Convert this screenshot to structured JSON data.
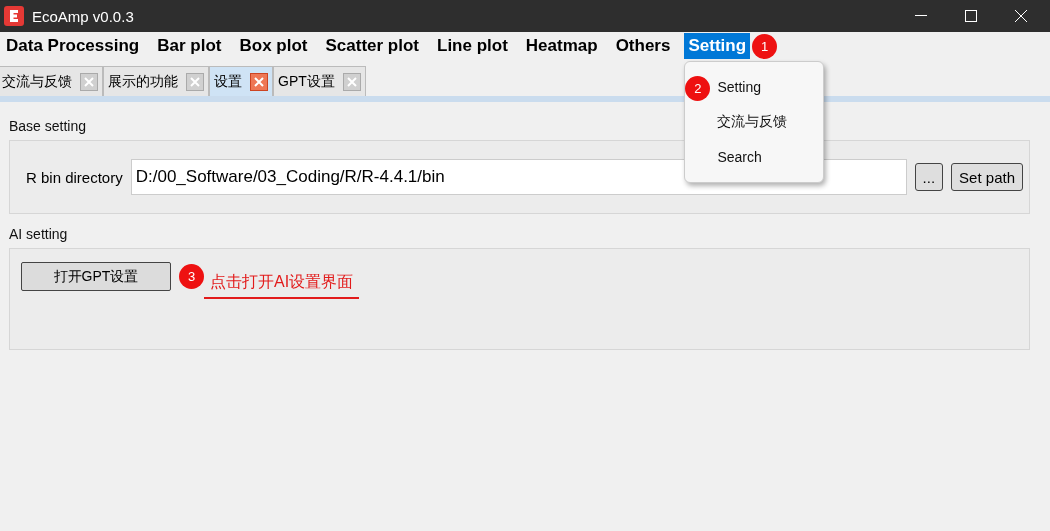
{
  "window": {
    "title": "EcoAmp v0.0.3"
  },
  "menu": [
    {
      "label": "Data Processing",
      "selected": false
    },
    {
      "label": "Bar plot",
      "selected": false
    },
    {
      "label": "Box plot",
      "selected": false
    },
    {
      "label": "Scatter plot",
      "selected": false
    },
    {
      "label": "Line plot",
      "selected": false
    },
    {
      "label": "Heatmap",
      "selected": false
    },
    {
      "label": "Others",
      "selected": false
    },
    {
      "label": "Setting",
      "selected": true
    }
  ],
  "dropdown": {
    "items": [
      "Setting",
      "交流与反馈",
      "Search"
    ]
  },
  "tabs": [
    {
      "label": "交流与反馈",
      "selected": false
    },
    {
      "label": "展示的功能",
      "selected": false
    },
    {
      "label": "设置",
      "selected": true
    },
    {
      "label": "GPT设置",
      "selected": false
    }
  ],
  "base_setting": {
    "title": "Base setting",
    "label": "R bin directory",
    "value": "D:/00_Software/03_Coding/R/R-4.4.1/bin",
    "buttons": [
      "...",
      "Set path"
    ]
  },
  "ai_setting": {
    "title": "AI setting",
    "button": "打开GPT设置"
  },
  "annotations": [
    {
      "marker": "1"
    },
    {
      "marker": "2"
    },
    {
      "marker": "3",
      "note": "点击打开AI设置界面"
    }
  ]
}
